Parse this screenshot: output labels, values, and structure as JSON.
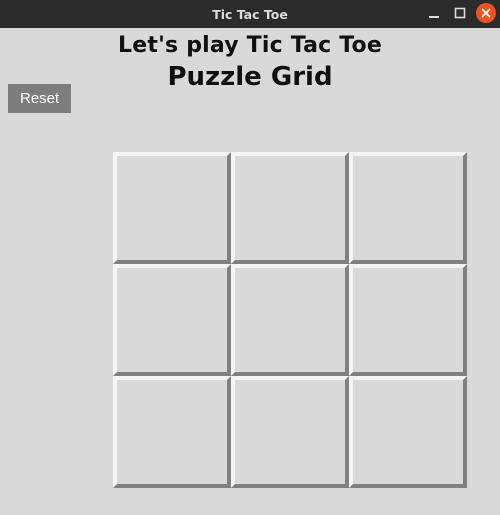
{
  "window": {
    "title": "Tic Tac Toe"
  },
  "banner": {
    "headline": "Let's play Tic Tac Toe",
    "grid_title": "Puzzle Grid"
  },
  "controls": {
    "reset_label": "Reset"
  },
  "board": {
    "cells": [
      {
        "value": ""
      },
      {
        "value": ""
      },
      {
        "value": ""
      },
      {
        "value": ""
      },
      {
        "value": ""
      },
      {
        "value": ""
      },
      {
        "value": ""
      },
      {
        "value": ""
      },
      {
        "value": ""
      }
    ]
  }
}
